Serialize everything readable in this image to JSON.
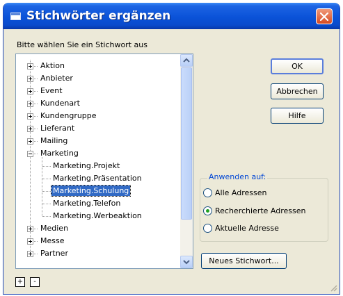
{
  "window": {
    "title": "Stichwörter ergänzen",
    "icon": "app-window-icon"
  },
  "prompt": "Bitte wählen Sie ein Stichwort aus",
  "tree": {
    "items": [
      {
        "label": "Aktion",
        "level": 0,
        "expander": "plus"
      },
      {
        "label": "Anbieter",
        "level": 0,
        "expander": "plus"
      },
      {
        "label": "Event",
        "level": 0,
        "expander": "plus"
      },
      {
        "label": "Kundenart",
        "level": 0,
        "expander": "plus"
      },
      {
        "label": "Kundengruppe",
        "level": 0,
        "expander": "plus"
      },
      {
        "label": "Lieferant",
        "level": 0,
        "expander": "plus"
      },
      {
        "label": "Mailing",
        "level": 0,
        "expander": "plus"
      },
      {
        "label": "Marketing",
        "level": 0,
        "expander": "minus"
      },
      {
        "label": "Marketing.Projekt",
        "level": 1,
        "expander": "none"
      },
      {
        "label": "Marketing.Präsentation",
        "level": 1,
        "expander": "none"
      },
      {
        "label": "Marketing.Schulung",
        "level": 1,
        "expander": "none",
        "selected": true
      },
      {
        "label": "Marketing.Telefon",
        "level": 1,
        "expander": "none"
      },
      {
        "label": "Marketing.Werbeaktion",
        "level": 1,
        "expander": "none"
      },
      {
        "label": "Medien",
        "level": 0,
        "expander": "plus"
      },
      {
        "label": "Messe",
        "level": 0,
        "expander": "plus"
      },
      {
        "label": "Partner",
        "level": 0,
        "expander": "plus"
      }
    ]
  },
  "buttons": {
    "ok": "OK",
    "cancel": "Abbrechen",
    "help": "Hilfe",
    "new_keyword": "Neues Stichwort...",
    "expand_all": "+",
    "collapse_all": "-"
  },
  "apply_group": {
    "legend": "Anwenden auf:",
    "options": [
      {
        "label": "Alle Adressen",
        "checked": false
      },
      {
        "label": "Recherchierte Adressen",
        "checked": true
      },
      {
        "label": "Aktuelle Adresse",
        "checked": false
      }
    ]
  },
  "colors": {
    "title_bar": "#0a52d8",
    "selection": "#316ac5",
    "legend_text": "#0046d5",
    "dialog_bg": "#ece9d8"
  }
}
